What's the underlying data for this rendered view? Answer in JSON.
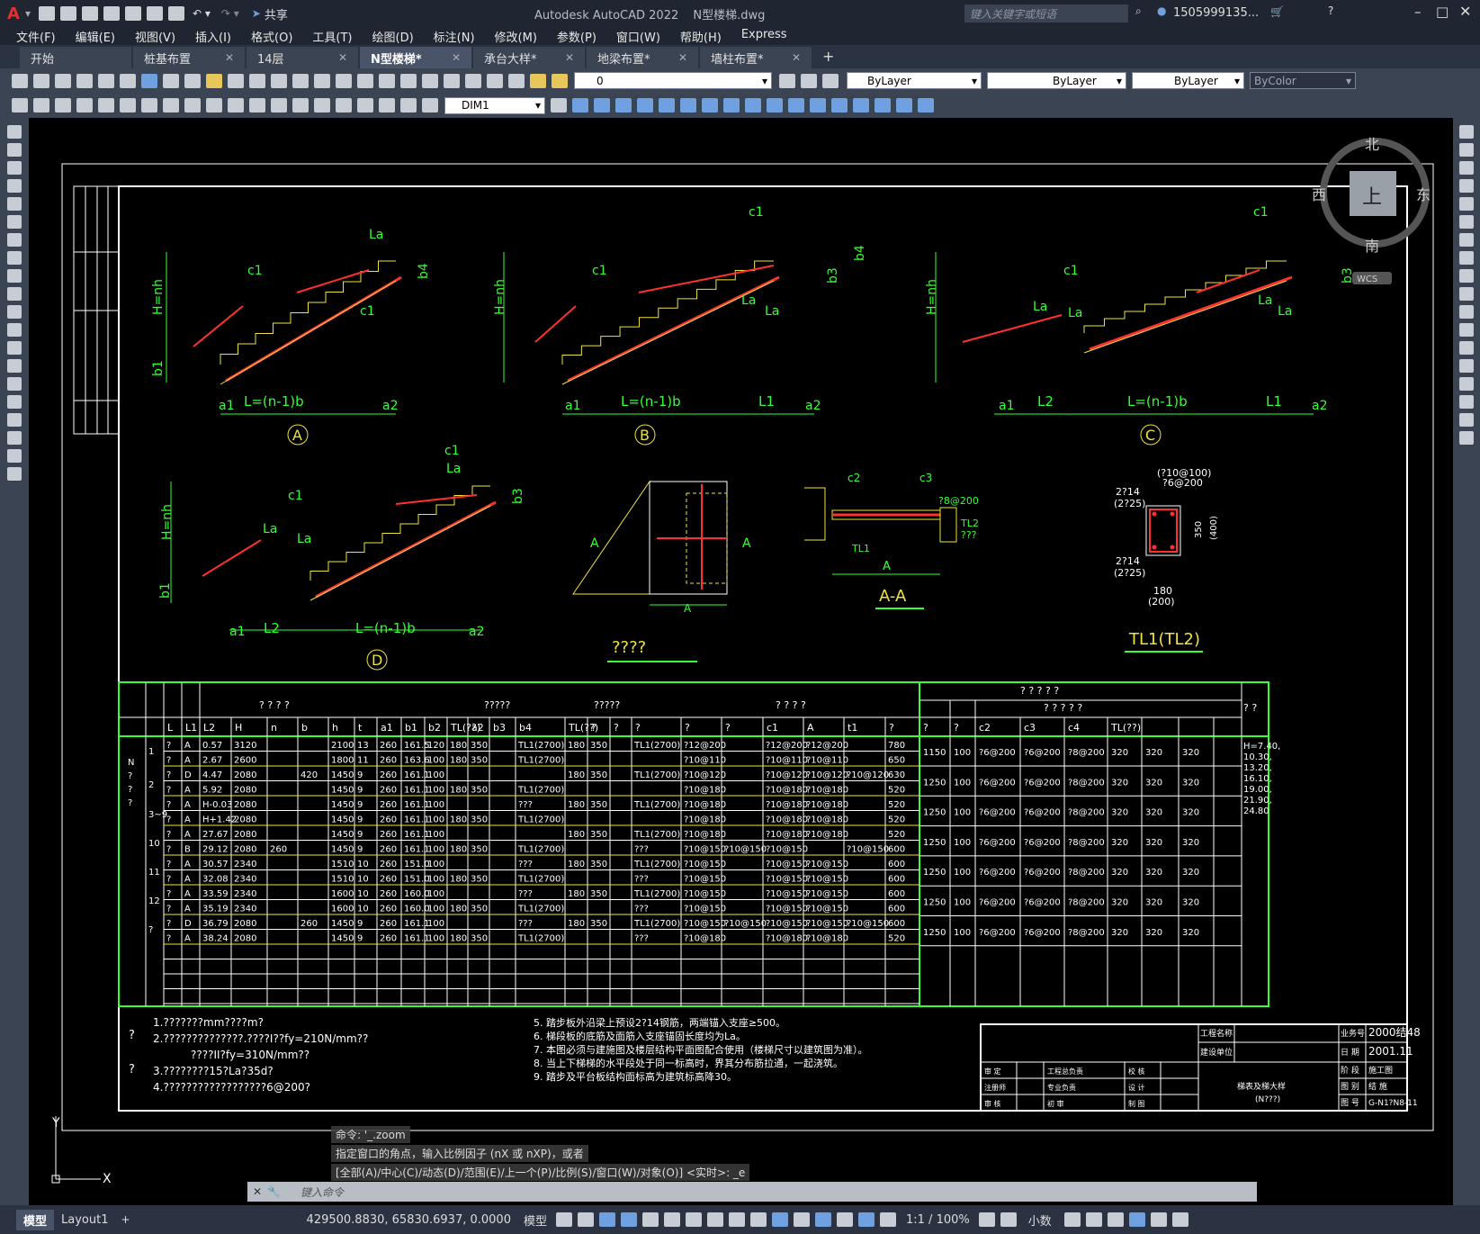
{
  "app": {
    "product": "Autodesk AutoCAD 2022",
    "document": "N型楼梯.dwg",
    "share_label": "共享",
    "search_placeholder": "键入关键字或短语",
    "user": "1505999135...",
    "window_controls": [
      "minimize-icon",
      "maximize-icon",
      "close-icon"
    ]
  },
  "menu": [
    "文件(F)",
    "编辑(E)",
    "视图(V)",
    "插入(I)",
    "格式(O)",
    "工具(T)",
    "绘图(D)",
    "标注(N)",
    "修改(M)",
    "参数(P)",
    "窗口(W)",
    "帮助(H)",
    "Express"
  ],
  "tabs": [
    {
      "label": "开始",
      "closable": false,
      "active": false
    },
    {
      "label": "桩基布置",
      "closable": true,
      "active": false
    },
    {
      "label": "14层",
      "closable": true,
      "active": false
    },
    {
      "label": "N型楼梯*",
      "closable": true,
      "active": true
    },
    {
      "label": "承台大样*",
      "closable": true,
      "active": false
    },
    {
      "label": "地梁布置*",
      "closable": true,
      "active": false
    },
    {
      "label": "墙柱布置*",
      "closable": true,
      "active": false
    }
  ],
  "toolbar": {
    "layer_value": "0",
    "color_value": "ByLayer",
    "linetype_value": "ByLayer",
    "lineweight_value": "ByLayer",
    "plotstyle_value": "ByColor",
    "dimstyle_value": "DIM1"
  },
  "viewcube": {
    "north": "北",
    "south": "南",
    "east": "东",
    "west": "西",
    "top": "上",
    "wcs": "WCS"
  },
  "drawing": {
    "labels": {
      "A": "A",
      "B": "B",
      "C": "C",
      "D": "D",
      "La": "La",
      "c1": "c1",
      "b3": "b3",
      "b4": "b4",
      "Hnh": "H=nh",
      "b1": "b1",
      "a1": "a1",
      "a2": "a2",
      "Ln": "L=(n-1)b",
      "L1": "L1",
      "L2": "L2",
      "plan_title": "????",
      "section_title": "A-A",
      "beam_title": "TL1(TL2)",
      "beam_top": "(?10@100)",
      "beam_top2": "?6@200",
      "beam_left1": "2?14",
      "beam_left2": "(2?25)",
      "beam_bot1": "2?14",
      "beam_bot2": "(2?25)",
      "beam_w": "180",
      "beam_w2": "(200)",
      "beam_h": "350",
      "beam_h2": "(400)",
      "sec_c2": "c2",
      "sec_c3": "c3",
      "sec_tl1": "TL1",
      "sec_tl2": "TL2",
      "sec_dim": "?8@200",
      "sec_a": "A",
      "sec_q": "???"
    },
    "table": {
      "header_top_groups": [
        "? ? ? ?",
        "?????",
        "?????",
        "? ? ? ?",
        "? ? ? ? ?",
        "? ? ? ? ?",
        "? ?"
      ],
      "columns": [
        "L",
        "L1",
        "L2",
        "H",
        "n",
        "b",
        "h",
        "t",
        "a1",
        "b1",
        "b2",
        "TL(??)",
        "a2",
        "b3",
        "b4",
        "TL(??)",
        "?",
        "?",
        "?",
        "?",
        "?",
        "c1",
        "A",
        "t1",
        "?",
        "?",
        "?",
        "c2",
        "c3",
        "c4",
        "TL(??)"
      ],
      "rows": [
        [
          "?",
          "A",
          "0.57",
          "3120",
          "",
          "",
          "2100",
          "13",
          "260",
          "161.5",
          "120",
          "180",
          "350",
          "",
          "TL1(2700)",
          "180",
          "350",
          "",
          "TL1(2700)",
          "?12@200",
          "",
          "?12@200",
          "?12@200",
          "",
          "780"
        ],
        [
          "?",
          "A",
          "2.67",
          "2600",
          "",
          "",
          "1800",
          "11",
          "260",
          "163.6",
          "100",
          "180",
          "350",
          "",
          "TL1(2700)",
          "",
          "",
          "",
          "",
          "?10@110",
          "",
          "?10@110",
          "?10@110",
          "",
          "650"
        ],
        [
          "?",
          "D",
          "4.47",
          "2080",
          "",
          "420",
          "1450",
          "9",
          "260",
          "161.1",
          "100",
          "",
          "",
          "",
          "",
          "180",
          "350",
          "",
          "TL1(2700)",
          "?10@120",
          "",
          "?10@120",
          "?10@120",
          "?10@120",
          "630"
        ],
        [
          "?",
          "A",
          "5.92",
          "2080",
          "",
          "",
          "1450",
          "9",
          "260",
          "161.1",
          "100",
          "180",
          "350",
          "",
          "TL1(2700)",
          "",
          "",
          "",
          "",
          "?10@180",
          "",
          "?10@180",
          "?10@180",
          "",
          "520"
        ],
        [
          "?",
          "A",
          "H-0.03",
          "2080",
          "",
          "",
          "1450",
          "9",
          "260",
          "161.1",
          "100",
          "",
          "",
          "",
          "???",
          "180",
          "350",
          "",
          "TL1(2700)",
          "?10@180",
          "",
          "?10@180",
          "?10@180",
          "",
          "520"
        ],
        [
          "?",
          "A",
          "H+1.42",
          "2080",
          "",
          "",
          "1450",
          "9",
          "260",
          "161.1",
          "100",
          "180",
          "350",
          "",
          "TL1(2700)",
          "",
          "",
          "",
          "",
          "?10@180",
          "",
          "?10@180",
          "?10@180",
          "",
          "520"
        ],
        [
          "?",
          "A",
          "27.67",
          "2080",
          "",
          "",
          "1450",
          "9",
          "260",
          "161.1",
          "100",
          "",
          "",
          "",
          "",
          "180",
          "350",
          "",
          "TL1(2700)",
          "?10@180",
          "",
          "?10@180",
          "?10@180",
          "",
          "520"
        ],
        [
          "?",
          "B",
          "29.12",
          "2080",
          "260",
          "",
          "1450",
          "9",
          "260",
          "161.1",
          "100",
          "180",
          "350",
          "",
          "TL1(2700)",
          "",
          "",
          "",
          "???",
          "?10@150",
          "?10@150",
          "?10@150",
          "",
          "?10@150",
          "600"
        ],
        [
          "?",
          "A",
          "30.57",
          "2340",
          "",
          "",
          "1510",
          "10",
          "260",
          "151.0",
          "100",
          "",
          "",
          "",
          "???",
          "180",
          "350",
          "",
          "TL1(2700)",
          "?10@150",
          "",
          "?10@150",
          "?10@150",
          "",
          "600"
        ],
        [
          "?",
          "A",
          "32.08",
          "2340",
          "",
          "",
          "1510",
          "10",
          "260",
          "151.0",
          "100",
          "180",
          "350",
          "",
          "TL1(2700)",
          "",
          "",
          "",
          "???",
          "?10@150",
          "",
          "?10@150",
          "?10@150",
          "",
          "600"
        ],
        [
          "?",
          "A",
          "33.59",
          "2340",
          "",
          "",
          "1600",
          "10",
          "260",
          "160.0",
          "100",
          "",
          "",
          "",
          "???",
          "180",
          "350",
          "",
          "TL1(2700)",
          "?10@150",
          "",
          "?10@150",
          "?10@150",
          "",
          "600"
        ],
        [
          "?",
          "A",
          "35.19",
          "2340",
          "",
          "",
          "1600",
          "10",
          "260",
          "160.0",
          "100",
          "180",
          "350",
          "",
          "TL1(2700)",
          "",
          "",
          "",
          "???",
          "?10@150",
          "",
          "?10@150",
          "?10@150",
          "",
          "600"
        ],
        [
          "?",
          "D",
          "36.79",
          "2080",
          "",
          "260",
          "1450",
          "9",
          "260",
          "161.1",
          "100",
          "",
          "",
          "",
          "???",
          "180",
          "350",
          "",
          "TL1(2700)",
          "?10@150",
          "?10@150",
          "?10@150",
          "?10@150",
          "?10@150",
          "600"
        ],
        [
          "?",
          "A",
          "38.24",
          "2080",
          "",
          "",
          "1450",
          "9",
          "260",
          "161.1",
          "100",
          "180",
          "350",
          "",
          "TL1(2700)",
          "",
          "",
          "",
          "???",
          "?10@180",
          "",
          "?10@180",
          "?10@180",
          "",
          "520"
        ]
      ],
      "right_rows": [
        [
          "1150",
          "100",
          "?6@200",
          "?6@200",
          "?8@200",
          "320",
          "320",
          "320"
        ],
        [
          "1250",
          "100",
          "?6@200",
          "?6@200",
          "?8@200",
          "320",
          "320",
          "320"
        ],
        [
          "1250",
          "100",
          "?6@200",
          "?6@200",
          "?8@200",
          "320",
          "320",
          "320"
        ],
        [
          "1250",
          "100",
          "?6@200",
          "?6@200",
          "?8@200",
          "320",
          "320",
          "320"
        ],
        [
          "1250",
          "100",
          "?6@200",
          "?6@200",
          "?8@200",
          "320",
          "320",
          "320"
        ],
        [
          "1250",
          "100",
          "?6@200",
          "?6@200",
          "?8@200",
          "320",
          "320",
          "320"
        ],
        [
          "1250",
          "100",
          "?6@200",
          "?6@200",
          "?8@200",
          "320",
          "320",
          "320"
        ]
      ],
      "group_labels": [
        "1",
        "2",
        "3~9",
        "10",
        "11",
        "12",
        "?"
      ],
      "notes_col": [
        "H=7.40,",
        "10.30,",
        "13.20,",
        "16.10,",
        "19.00,",
        "21.90,",
        "24.80"
      ],
      "first_col": "N\n?\n?\n?"
    },
    "notes_left": [
      "1.???????mm????m?",
      "2.??????????????.????I??fy=210N/mm??",
      "????II?fy=310N/mm??",
      "3.????????15?La?35d?",
      "4.??????????????????6@200?"
    ],
    "notes_right": [
      "5. 踏步板外沿梁上预设2?14钢筋，两端锚入支座≥500。",
      "6. 梯段板的底筋及面筋入支座锚固长度均为La。",
      "7. 本图必须与建施图及楼层结构平面图配合使用（楼梯尺寸以建筑图为准）。",
      "8. 当上下梯梯的水平段处于同一标高时，界其分布筋拉通，一起浇筑。",
      "9. 踏步及平台板结构面标高为建筑标高降30。"
    ],
    "titleblock": {
      "project_name_label": "工程名称",
      "construction_label": "建设单位",
      "job_no_label": "业务号",
      "job_no": "2000结48",
      "date_label": "日 期",
      "date": "2001.11",
      "stage_label": "阶 段",
      "stage": "施工图",
      "discipline_label": "图 别",
      "discipline": "结 施",
      "drawing_no_label": "图 号",
      "drawing_no": "G-N1?N8-11",
      "drawing_title": "梯表及梯大样",
      "drawing_sub": "(N???)",
      "row_labels": [
        "审 定",
        "工程总负责",
        "校 核",
        "注册师",
        "专业负责",
        "设 计",
        "审 核",
        "初 审",
        "制 图"
      ]
    }
  },
  "command": {
    "history": [
      "命令: '_.zoom",
      "指定窗口的角点，输入比例因子 (nX 或 nXP)，或者",
      "[全部(A)/中心(C)/动态(D)/范围(E)/上一个(P)/比例(S)/窗口(W)/对象(O)] <实时>: _e"
    ],
    "placeholder": "键入命令"
  },
  "status": {
    "layout_tabs": [
      "模型",
      "Layout1"
    ],
    "coords": "429500.8830, 65830.6937, 0.0000",
    "mode": "模型",
    "scale": "1:1 / 100%",
    "units": "小数"
  }
}
